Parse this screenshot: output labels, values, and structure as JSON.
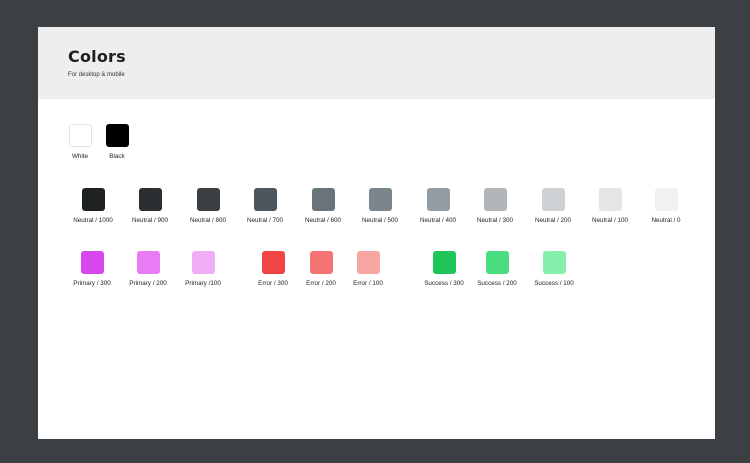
{
  "page": {
    "title": "Colors",
    "subtitle": "For desktop & mobile"
  },
  "rows": {
    "base": [
      {
        "label": "White",
        "color": "#ffffff",
        "bordered": true
      },
      {
        "label": "Black",
        "color": "#000000",
        "bordered": false
      }
    ],
    "neutral": [
      {
        "label": "Neutral / 1000",
        "color": "#1f2223"
      },
      {
        "label": "Neutral / 900",
        "color": "#2b2f31"
      },
      {
        "label": "Neutral / 800",
        "color": "#3a3f42"
      },
      {
        "label": "Neutral / 700",
        "color": "#4e565b"
      },
      {
        "label": "Neutral / 600",
        "color": "#69737a"
      },
      {
        "label": "Neutral / 500",
        "color": "#7b858c"
      },
      {
        "label": "Neutral / 400",
        "color": "#959ca1"
      },
      {
        "label": "Neutral / 300",
        "color": "#b1b6b9"
      },
      {
        "label": "Neutral / 200",
        "color": "#cdd1d3"
      },
      {
        "label": "Neutral / 100",
        "color": "#e3e5e6"
      },
      {
        "label": "Neutral / 0",
        "color": "#f0f1f2"
      }
    ],
    "accents": [
      {
        "label": "Primary / 300",
        "color": "#d847ee"
      },
      {
        "label": "Primary / 200",
        "color": "#e97bf5"
      },
      {
        "label": "Primary /100",
        "color": "#f0aef8"
      },
      {
        "label": "Error / 300",
        "color": "#ef4545"
      },
      {
        "label": "Error / 200",
        "color": "#f57373"
      },
      {
        "label": "Error / 100",
        "color": "#f8a6a2"
      },
      {
        "label": "Success / 300",
        "color": "#1ec65a"
      },
      {
        "label": "Success / 200",
        "color": "#4ade80"
      },
      {
        "label": "Success / 100",
        "color": "#86efac"
      }
    ]
  }
}
